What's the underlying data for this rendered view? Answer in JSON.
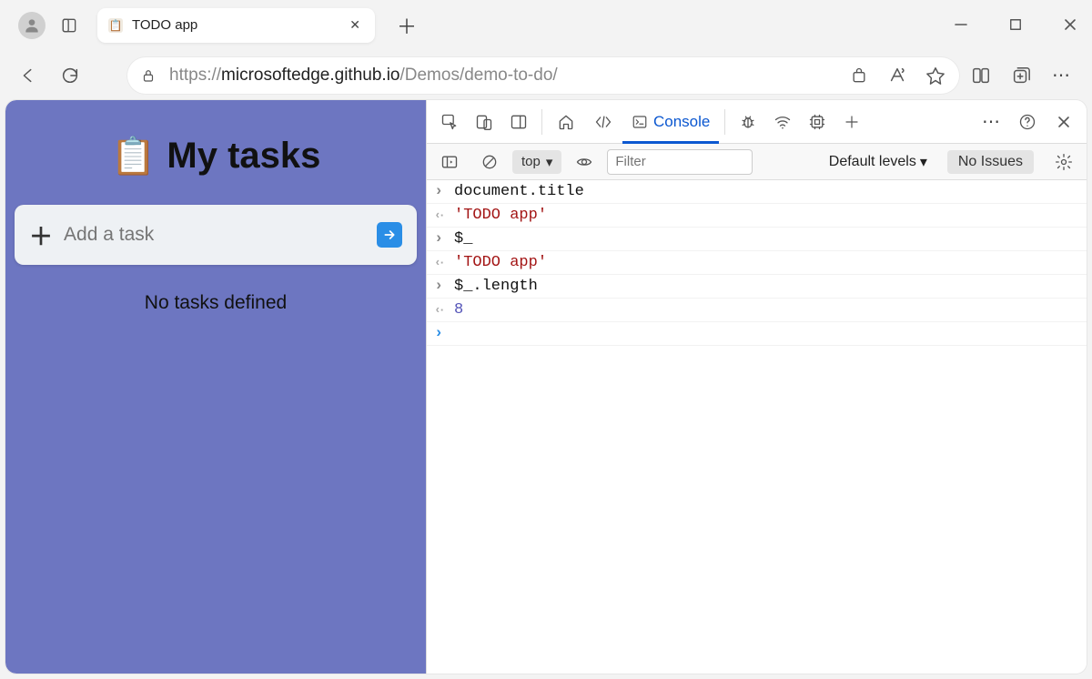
{
  "browser": {
    "tab_title": "TODO app",
    "url_prefix": "https://",
    "url_host": "microsoftedge.github.io",
    "url_path": "/Demos/demo-to-do/"
  },
  "page": {
    "title": "My tasks",
    "add_placeholder": "Add a task",
    "empty_msg": "No tasks defined"
  },
  "devtools": {
    "tab_console": "Console",
    "ctx": "top",
    "filter_placeholder": "Filter",
    "levels_label": "Default levels",
    "issues_label": "No Issues",
    "lines": [
      {
        "kind": "input",
        "text": "document.title"
      },
      {
        "kind": "output",
        "text": "'TODO app'",
        "cls": "code-str"
      },
      {
        "kind": "input",
        "text": "$_"
      },
      {
        "kind": "output",
        "text": "'TODO app'",
        "cls": "code-str"
      },
      {
        "kind": "input",
        "text": "$_.length"
      },
      {
        "kind": "output",
        "text": "8",
        "cls": "code-num"
      }
    ]
  }
}
